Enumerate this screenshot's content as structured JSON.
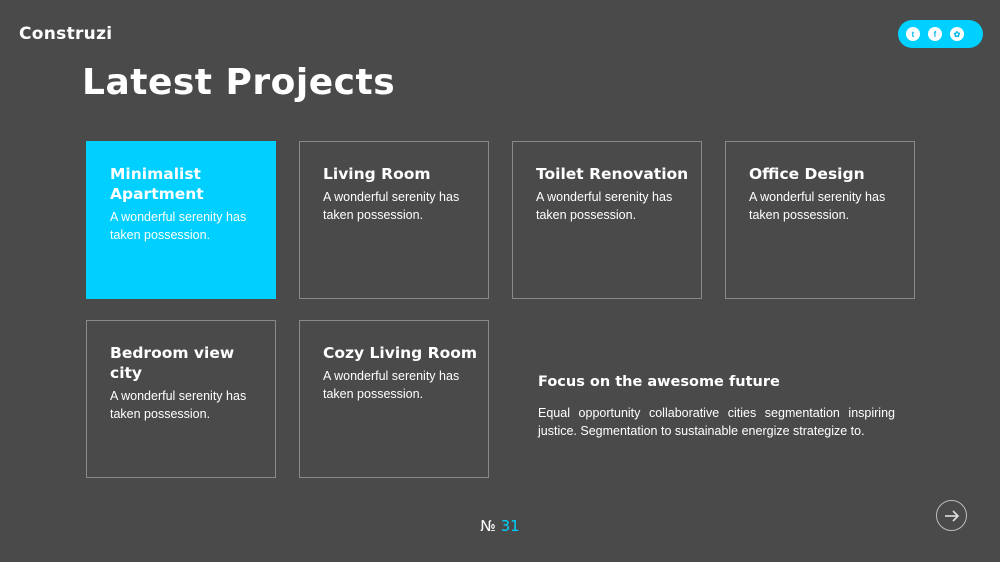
{
  "brand": {
    "name": "Construzi"
  },
  "social": {
    "accent": "#00d0ff",
    "items": [
      {
        "icon": "twitter-icon",
        "glyph": "t"
      },
      {
        "icon": "facebook-icon",
        "glyph": "f"
      },
      {
        "icon": "dribbble-icon",
        "glyph": "✿"
      }
    ]
  },
  "page": {
    "title": "Latest Projects"
  },
  "projects": [
    {
      "title": "Minimalist Apartment",
      "description": "A wonderful serenity has taken possession.",
      "active": true
    },
    {
      "title": "Living Room",
      "description": "A wonderful serenity has taken possession.",
      "active": false
    },
    {
      "title": "Toilet Renovation",
      "description": "A wonderful serenity has taken possession.",
      "active": false
    },
    {
      "title": "Office Design",
      "description": "A wonderful serenity has taken possession.",
      "active": false
    },
    {
      "title": "Bedroom view city",
      "description": "A wonderful serenity has taken possession.",
      "active": false
    },
    {
      "title": "Cozy Living Room",
      "description": "A wonderful serenity has taken possession.",
      "active": false
    }
  ],
  "focus": {
    "heading": "Focus on the awesome future",
    "body": "Equal opportunity collaborative cities segmentation inspiring justice. Segmentation to sustainable energize strategize to."
  },
  "pager": {
    "prefix": "№",
    "number": "31"
  },
  "nav": {
    "next_icon": "arrow-right-icon"
  }
}
